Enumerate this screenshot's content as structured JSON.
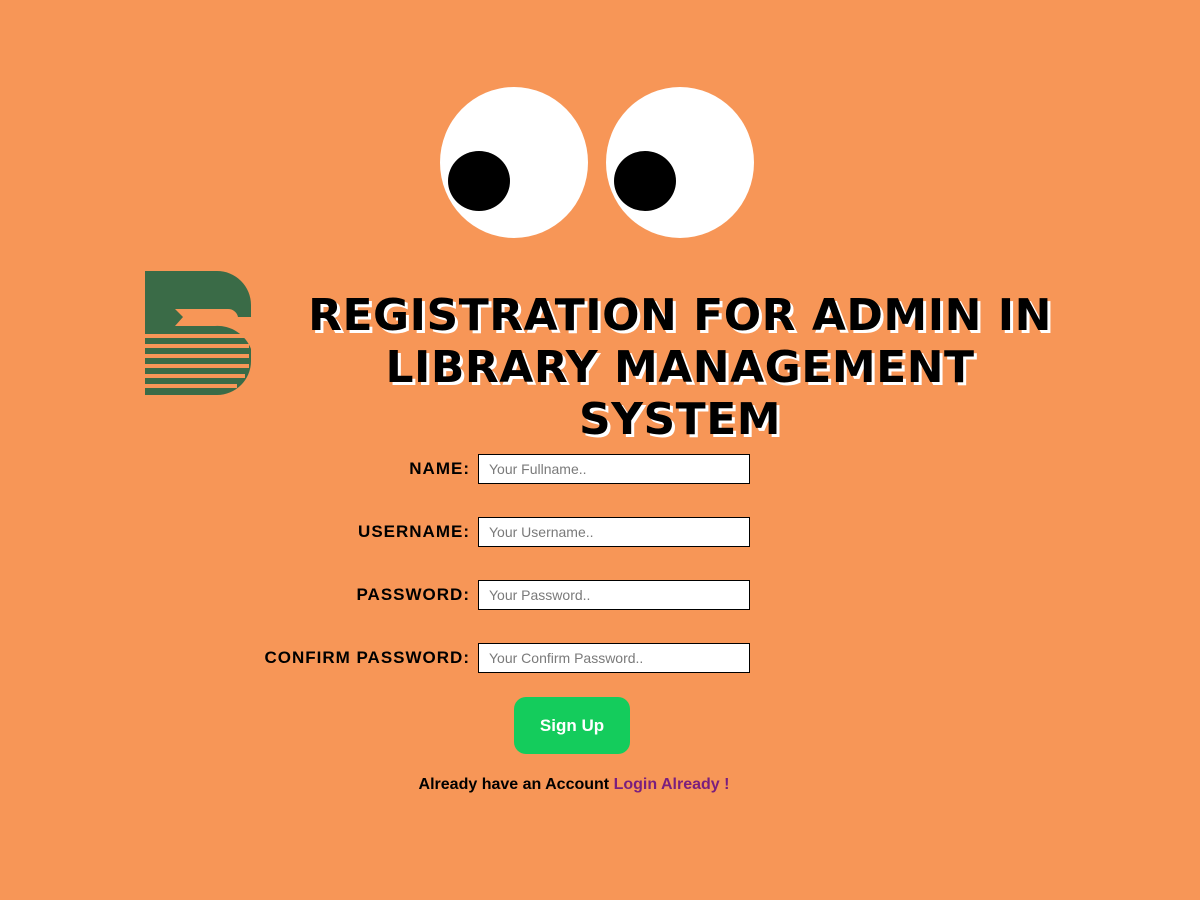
{
  "header": {
    "title_line1": "REGISTRATION FOR ADMIN IN",
    "title_line2": "LIBRARY MANAGEMENT SYSTEM"
  },
  "logo": {
    "icon": "library-book-logo",
    "color": "#3a6b47"
  },
  "form": {
    "name": {
      "label": "NAME:",
      "placeholder": "Your Fullname.."
    },
    "username": {
      "label": "USERNAME:",
      "placeholder": "Your Username.."
    },
    "password": {
      "label": "PASSWORD:",
      "placeholder": "Your Password.."
    },
    "confirm_password": {
      "label": "CONFIRM PASSWORD:",
      "placeholder": "Your Confirm Password.."
    },
    "submit_label": "Sign Up"
  },
  "login": {
    "prompt": "Already have an Account",
    "link_text": "Login Already !"
  },
  "colors": {
    "background": "#f79657",
    "button": "#14cc5c",
    "link": "#7a1e7e"
  }
}
